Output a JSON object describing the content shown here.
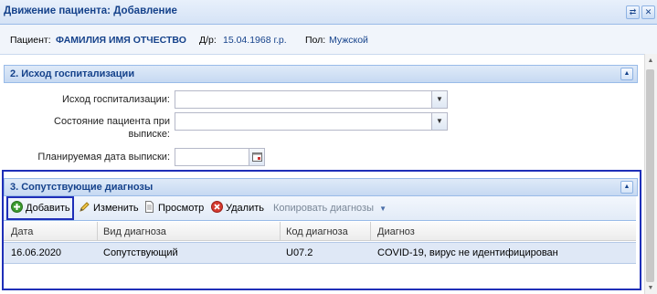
{
  "window": {
    "title": "Движение пациента: Добавление",
    "tools": [
      "refresh-icon",
      "close-icon"
    ]
  },
  "patient": {
    "label": "Пациент:",
    "name": "ФАМИЛИЯ ИМЯ ОТЧЕСТВО",
    "dob_label": "Д/р:",
    "dob": "15.04.1968 г.р.",
    "sex_label": "Пол:",
    "sex": "Мужской"
  },
  "section2": {
    "title": "2. Исход госпитализации",
    "fields": {
      "outcome_label": "Исход госпитализации:",
      "outcome_value": "",
      "state_label_line1": "Состояние пациента при",
      "state_label_line2": "выписке:",
      "state_value": "",
      "date_label": "Планируемая дата выписки:",
      "date_value": ""
    }
  },
  "section3": {
    "title": "3. Сопутствующие диагнозы",
    "toolbar": {
      "add": "Добавить",
      "edit": "Изменить",
      "view": "Просмотр",
      "delete": "Удалить",
      "copy": "Копировать диагнозы"
    },
    "columns": [
      "Дата",
      "Вид диагноза",
      "Код диагноза",
      "Диагноз"
    ],
    "rows": [
      [
        "16.06.2020",
        "Сопутствующий",
        "U07.2",
        "COVID-19, вирус не идентифицирован"
      ]
    ]
  },
  "colors": {
    "header_text": "#15428b",
    "highlight": "#1f2fb8",
    "selected_row": "#dfe8f6"
  }
}
